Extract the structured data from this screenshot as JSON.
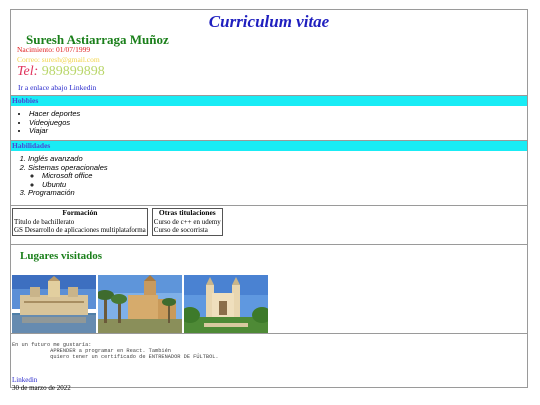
{
  "header": {
    "title": "Curriculum vitae",
    "name": "Suresh Astiarraga Muñoz",
    "birth": "Nacimiento: 01/07/1999",
    "email": "Correo: suresh@gmail.com",
    "tel_label": "Tel:",
    "tel_number": "989899898",
    "link_text": "Ir a enlace abajo Linkedin"
  },
  "hobbies": {
    "heading": "Hobbies",
    "items": [
      "Hacer deportes",
      "Videojuegos",
      "Viajar"
    ]
  },
  "skills": {
    "heading": "Habilidades",
    "item1": "Inglés avanzado",
    "item2": "Sistemas operacionales",
    "sub": [
      "Microsoft office",
      "Ubuntu"
    ],
    "item3": "Programación"
  },
  "table_formation": {
    "header": "Formación",
    "rows": [
      "Título de bachillerato",
      "GS Desarrollo de aplicaciones multiplataforma"
    ]
  },
  "table_other": {
    "header": "Otras titulaciones",
    "rows": [
      "Curso de c++ en udemy",
      "Curso de socorrista"
    ]
  },
  "places": {
    "heading": "Lugares visitados"
  },
  "future_text": "En un futuro me gustaría:\n            APRENDER a programar en React. También\n            quiero tener un certificado de ENTRENADOR DE FÚLTBOL.",
  "footer": {
    "link": "Linkedin",
    "date": "30 de marzo de 2022"
  },
  "colors": {
    "section_bar": "#19ecf5",
    "title_blue": "#1f1fbf",
    "name_green": "#1a7f1a"
  }
}
